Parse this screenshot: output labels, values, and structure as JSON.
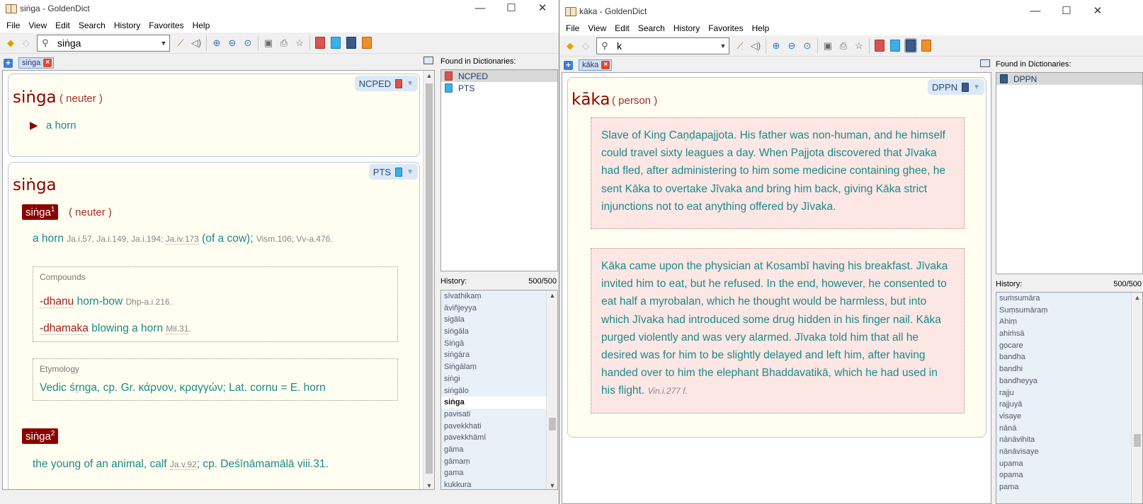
{
  "left": {
    "window_title": "siṅga - GoldenDict",
    "menu": [
      "File",
      "View",
      "Edit",
      "Search",
      "History",
      "Favorites",
      "Help"
    ],
    "search_value": "siṅga",
    "tab_label": "siṅga",
    "found_title": "Found in Dictionaries:",
    "found": [
      {
        "name": "NCPED",
        "icon": "di-red",
        "selected": true
      },
      {
        "name": "PTS",
        "icon": "di-blue",
        "selected": false
      }
    ],
    "history_title": "History:",
    "history_count": "500/500",
    "history": [
      "sīvathikaṃ",
      "āviñjeyya",
      "sigāla",
      "siṅgāla",
      "Siṅgā",
      "siṅgāra",
      "Siṅgālaṃ",
      "siṅgi",
      "siṅgālo",
      "siṅga",
      "pavisati",
      "pavekkhati",
      "pavekkhāmī",
      "gāma",
      "gāmaṃ",
      "gama",
      "kukkura"
    ],
    "history_selected": 9,
    "ncped": {
      "badge": "NCPED",
      "headword": "siṅga",
      "pos": "( neuter )",
      "bullet": "▶",
      "meaning": "a horn"
    },
    "pts": {
      "badge": "PTS",
      "headword": "siṅga",
      "entry1": {
        "tag": "siṅga",
        "sup": "1",
        "pos": "( neuter )",
        "meaning": "a horn",
        "refs": [
          "Ja.i.57",
          "Ja.i.149",
          "Ja.i.194",
          "Ja.iv.173"
        ],
        "note": "(of a cow);",
        "refs2": [
          "Vism.106",
          "Vv-a.476"
        ]
      },
      "compounds": {
        "label": "Compounds",
        "c1_term": "-dhanu",
        "c1_meaning": "horn-bow",
        "c1_ref": "Dhp-a.i.216",
        "c2_term": "-dhamaka",
        "c2_meaning": "blowing a horn",
        "c2_ref": "Mil.31"
      },
      "etymology": {
        "label": "Etymology",
        "text": "Vedic śṛnga, cp. Gr. κάρνον, κραγγών; Lat. cornu = E. horn"
      },
      "entry2": {
        "tag": "siṅga",
        "sup": "2",
        "meaning": "the young of an animal, calf",
        "ref": "Ja.v.92",
        "tail": "; cp. Deśīnāmamālā viii.31."
      }
    }
  },
  "right": {
    "window_title": "kāka - GoldenDict",
    "menu": [
      "File",
      "View",
      "Edit",
      "Search",
      "History",
      "Favorites",
      "Help"
    ],
    "search_value": "k",
    "tab_label": "kāka",
    "found_title": "Found in Dictionaries:",
    "found": [
      {
        "name": "DPPN",
        "icon": "di-navy",
        "selected": true
      }
    ],
    "history_title": "History:",
    "history_count": "500/500",
    "history": [
      "suṁsumāra",
      "Suṃsumāraṃ",
      "Ahiṃ",
      "ahiṁsā",
      "gocare",
      "bandha",
      "bandhi",
      "bandheyya",
      "rajju",
      "rajjuyā",
      "visaye",
      "nānā",
      "nānāvihita",
      "nānāvisaye",
      "upama",
      "opama",
      "pama"
    ],
    "dppn": {
      "badge": "DPPN",
      "headword": "kāka",
      "pos": "( person )",
      "para1": "Slave of King Caṇḍapajjota. His father was non-human, and he himself could travel sixty leagues a day. When Pajjota discovered that Jīvaka had fled, after administering to him some medicine containing ghee, he sent Kāka to overtake Jīvaka and bring him back, giving Kāka strict injunctions not to eat anything offered by Jīvaka.",
      "para2": "Kāka came upon the physician at Kosambī having his breakfast. Jīvaka invited him to eat, but he refused. In the end, however, he consented to eat half a myrobalan, which he thought would be harmless, but into which Jīvaka had introduced some drug hidden in his finger nail. Kāka purged violently and was very alarmed. Jīvaka told him that all he desired was for him to be slightly delayed and left him, after having handed over to him the elephant Bhaddavatikā, which he had used in his flight.",
      "para2_ref": "Vin.i.277 f."
    }
  },
  "window_buttons": {
    "min": "—",
    "max": "☐",
    "close": "✕"
  }
}
